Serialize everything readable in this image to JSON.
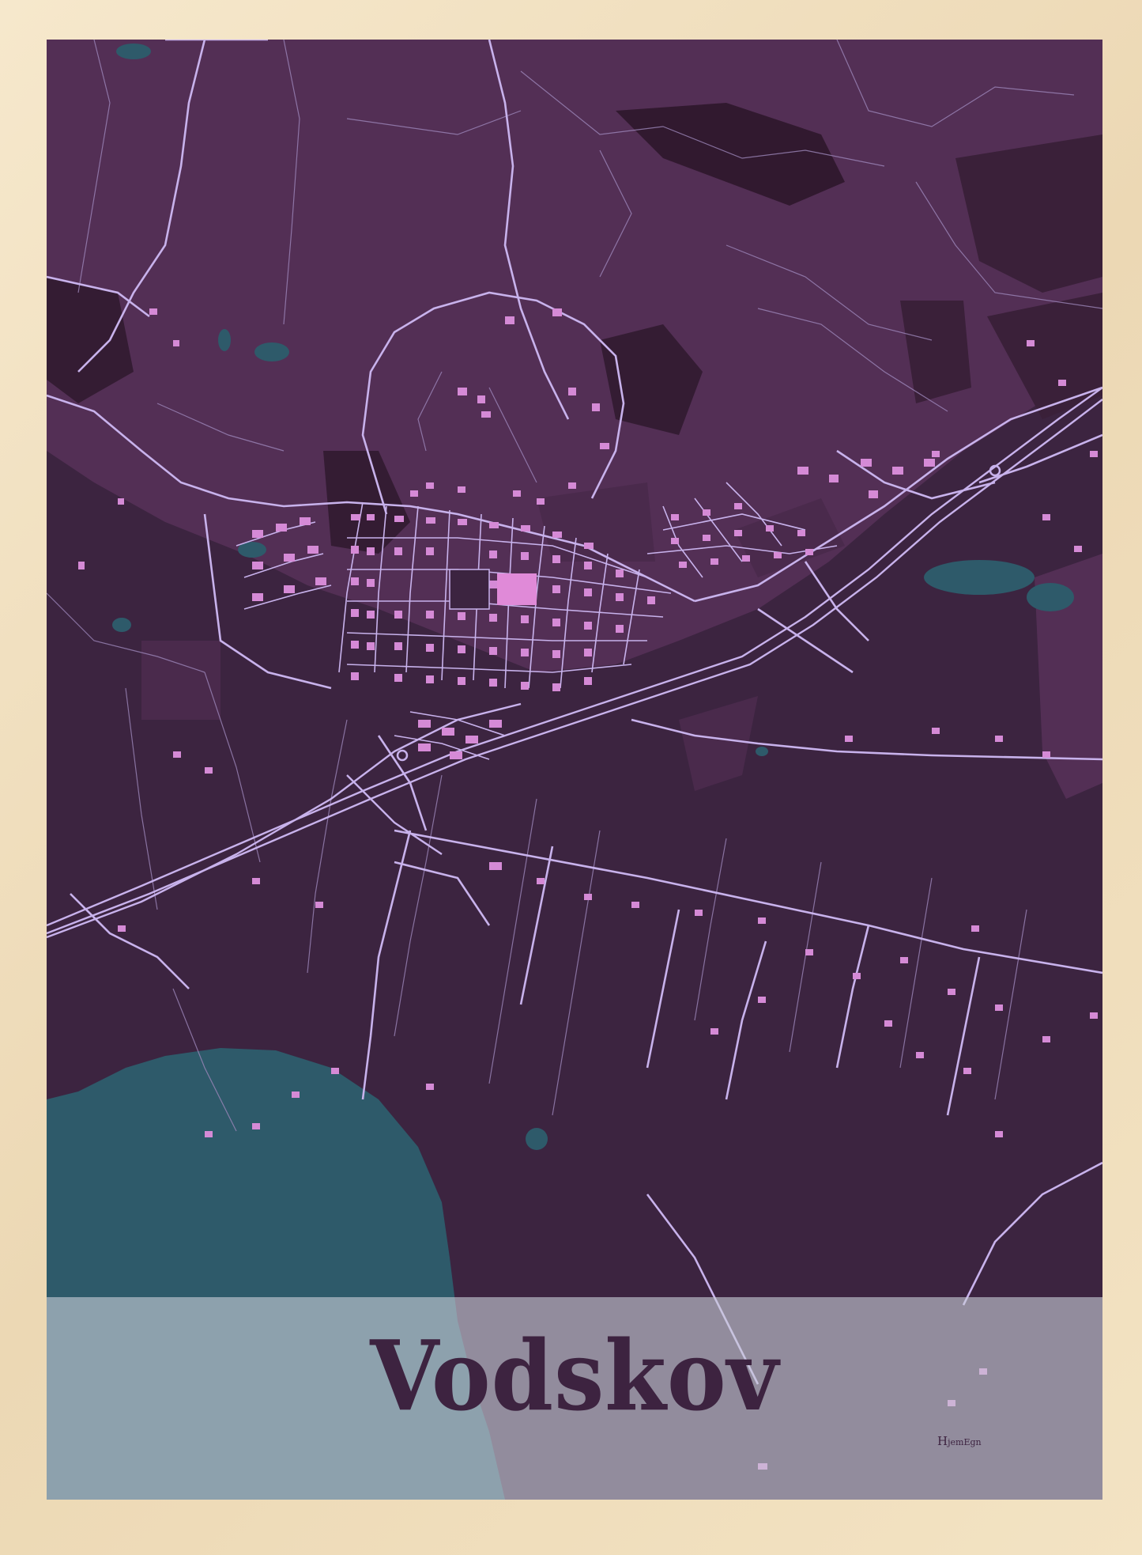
{
  "poster": {
    "title": "Vodskov",
    "brand_initial": "H",
    "brand_rest": "jemEgn"
  },
  "map": {
    "colors": {
      "background": "#3c2440",
      "landuse": "#532f55",
      "forest": "#31192f",
      "water": "#2e5a6a",
      "roads": "#c8b2ec",
      "buildings": "#d58ad6",
      "highlight": "#e08ad8",
      "title_band": "#c8cdd7",
      "title_text": "#3d2340"
    },
    "icons": [
      "roundabout-icon"
    ]
  }
}
